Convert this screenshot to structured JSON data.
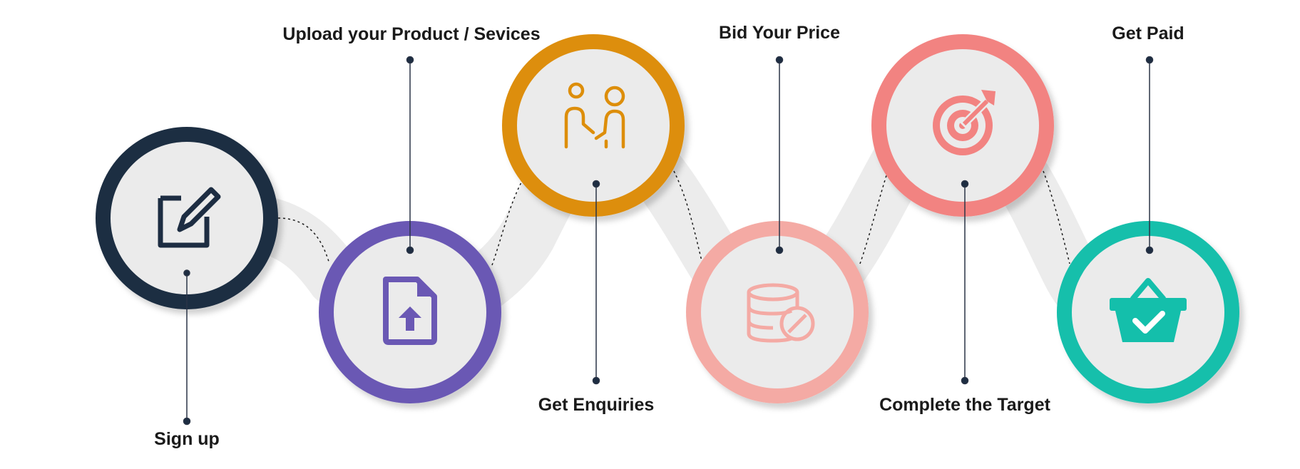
{
  "steps": [
    {
      "label": "Sign up",
      "ring_color": "#1d2d42",
      "icon": "edit-icon"
    },
    {
      "label": "Upload your Product / Sevices",
      "ring_color": "#6a58b4",
      "icon": "file-upload-icon"
    },
    {
      "label": "Get Enquiries",
      "ring_color": "#dd8e0b",
      "icon": "handshake-people-icon"
    },
    {
      "label": "Bid Your Price",
      "ring_color": "#f4aaa4",
      "icon": "database-blocked-icon"
    },
    {
      "label": "Complete the Target",
      "ring_color": "#f28381",
      "icon": "target-icon"
    },
    {
      "label": "Get Paid",
      "ring_color": "#14bfab",
      "icon": "shopping-basket-check-icon"
    }
  ],
  "colors": {
    "background": "#ffffff",
    "circle_fill": "#ebebeb",
    "path_fill": "#ececec",
    "connector_line": "#2a3446",
    "dashed_line": "#1e1e1e",
    "label_text": "#1a1a1a"
  }
}
